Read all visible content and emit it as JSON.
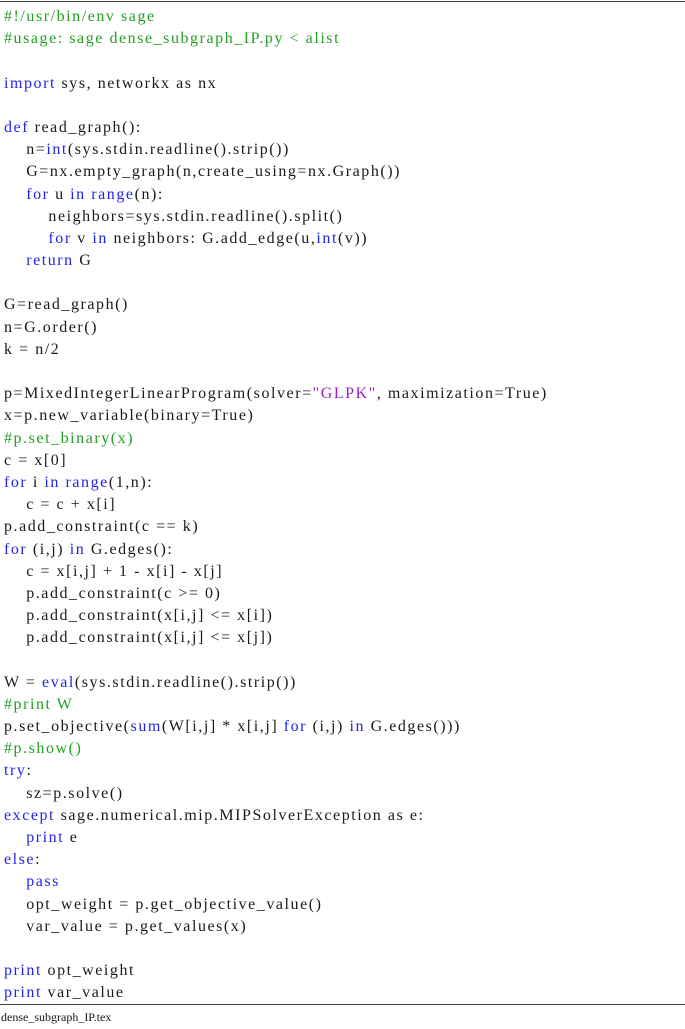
{
  "document": {
    "caption": "dense_subgraph_IP.tex",
    "colors": {
      "keyword": "#2424e8",
      "comment": "#22a022",
      "string": "#9a1fc0",
      "text": "#1a1a1a"
    },
    "indent_unit": "    ",
    "lines": [
      {
        "indent": 0,
        "tokens": [
          {
            "t": "comment",
            "v": "#!/usr/bin/env sage"
          }
        ]
      },
      {
        "indent": 0,
        "tokens": [
          {
            "t": "comment",
            "v": "#usage: sage dense_subgraph_IP.py < alist"
          }
        ]
      },
      {
        "indent": 0,
        "tokens": []
      },
      {
        "indent": 0,
        "tokens": [
          {
            "t": "kw",
            "v": "import"
          },
          {
            "t": "plain",
            "v": " sys, networkx as nx"
          }
        ]
      },
      {
        "indent": 0,
        "tokens": []
      },
      {
        "indent": 0,
        "tokens": [
          {
            "t": "kw",
            "v": "def"
          },
          {
            "t": "plain",
            "v": " read_graph():"
          }
        ]
      },
      {
        "indent": 1,
        "tokens": [
          {
            "t": "plain",
            "v": "n="
          },
          {
            "t": "kw",
            "v": "int"
          },
          {
            "t": "plain",
            "v": "(sys.stdin.readline().strip())"
          }
        ]
      },
      {
        "indent": 1,
        "tokens": [
          {
            "t": "plain",
            "v": "G=nx.empty_graph(n,create_using=nx.Graph())"
          }
        ]
      },
      {
        "indent": 1,
        "tokens": [
          {
            "t": "kw",
            "v": "for"
          },
          {
            "t": "plain",
            "v": " u "
          },
          {
            "t": "kw",
            "v": "in"
          },
          {
            "t": "plain",
            "v": " "
          },
          {
            "t": "kw",
            "v": "range"
          },
          {
            "t": "plain",
            "v": "(n):"
          }
        ]
      },
      {
        "indent": 2,
        "tokens": [
          {
            "t": "plain",
            "v": "neighbors=sys.stdin.readline().split()"
          }
        ]
      },
      {
        "indent": 2,
        "tokens": [
          {
            "t": "kw",
            "v": "for"
          },
          {
            "t": "plain",
            "v": " v "
          },
          {
            "t": "kw",
            "v": "in"
          },
          {
            "t": "plain",
            "v": " neighbors: G.add_edge(u,"
          },
          {
            "t": "kw",
            "v": "int"
          },
          {
            "t": "plain",
            "v": "(v))"
          }
        ]
      },
      {
        "indent": 1,
        "tokens": [
          {
            "t": "kw",
            "v": "return"
          },
          {
            "t": "plain",
            "v": " G"
          }
        ]
      },
      {
        "indent": 0,
        "tokens": []
      },
      {
        "indent": 0,
        "tokens": [
          {
            "t": "plain",
            "v": "G=read_graph()"
          }
        ]
      },
      {
        "indent": 0,
        "tokens": [
          {
            "t": "plain",
            "v": "n=G.order()"
          }
        ]
      },
      {
        "indent": 0,
        "tokens": [
          {
            "t": "plain",
            "v": "k = n/2"
          }
        ]
      },
      {
        "indent": 0,
        "tokens": []
      },
      {
        "indent": 0,
        "tokens": [
          {
            "t": "plain",
            "v": "p=MixedIntegerLinearProgram(solver="
          },
          {
            "t": "string",
            "v": "\"GLPK\""
          },
          {
            "t": "plain",
            "v": ", maximization=True)"
          }
        ]
      },
      {
        "indent": 0,
        "tokens": [
          {
            "t": "plain",
            "v": "x=p.new_variable(binary=True)"
          }
        ]
      },
      {
        "indent": 0,
        "tokens": [
          {
            "t": "comment",
            "v": "#p.set_binary(x)"
          }
        ]
      },
      {
        "indent": 0,
        "tokens": [
          {
            "t": "plain",
            "v": "c = x[0]"
          }
        ]
      },
      {
        "indent": 0,
        "tokens": [
          {
            "t": "kw",
            "v": "for"
          },
          {
            "t": "plain",
            "v": " i "
          },
          {
            "t": "kw",
            "v": "in"
          },
          {
            "t": "plain",
            "v": " "
          },
          {
            "t": "kw",
            "v": "range"
          },
          {
            "t": "plain",
            "v": "(1,n):"
          }
        ]
      },
      {
        "indent": 1,
        "tokens": [
          {
            "t": "plain",
            "v": "c = c + x[i]"
          }
        ]
      },
      {
        "indent": 0,
        "tokens": [
          {
            "t": "plain",
            "v": "p.add_constraint(c == k)"
          }
        ]
      },
      {
        "indent": 0,
        "tokens": [
          {
            "t": "kw",
            "v": "for"
          },
          {
            "t": "plain",
            "v": " (i,j) "
          },
          {
            "t": "kw",
            "v": "in"
          },
          {
            "t": "plain",
            "v": " G.edges():"
          }
        ]
      },
      {
        "indent": 1,
        "tokens": [
          {
            "t": "plain",
            "v": "c = x[i,j] + 1 - x[i] - x[j]"
          }
        ]
      },
      {
        "indent": 1,
        "tokens": [
          {
            "t": "plain",
            "v": "p.add_constraint(c >= 0)"
          }
        ]
      },
      {
        "indent": 1,
        "tokens": [
          {
            "t": "plain",
            "v": "p.add_constraint(x[i,j] <= x[i])"
          }
        ]
      },
      {
        "indent": 1,
        "tokens": [
          {
            "t": "plain",
            "v": "p.add_constraint(x[i,j] <= x[j])"
          }
        ]
      },
      {
        "indent": 0,
        "tokens": []
      },
      {
        "indent": 0,
        "tokens": [
          {
            "t": "plain",
            "v": "W = "
          },
          {
            "t": "kw",
            "v": "eval"
          },
          {
            "t": "plain",
            "v": "(sys.stdin.readline().strip())"
          }
        ]
      },
      {
        "indent": 0,
        "tokens": [
          {
            "t": "comment",
            "v": "#print W"
          }
        ]
      },
      {
        "indent": 0,
        "tokens": [
          {
            "t": "plain",
            "v": "p.set_objective("
          },
          {
            "t": "kw",
            "v": "sum"
          },
          {
            "t": "plain",
            "v": "(W[i,j] * x[i,j] "
          },
          {
            "t": "kw",
            "v": "for"
          },
          {
            "t": "plain",
            "v": " (i,j) "
          },
          {
            "t": "kw",
            "v": "in"
          },
          {
            "t": "plain",
            "v": " G.edges()))"
          }
        ]
      },
      {
        "indent": 0,
        "tokens": [
          {
            "t": "comment",
            "v": "#p.show()"
          }
        ]
      },
      {
        "indent": 0,
        "tokens": [
          {
            "t": "kw",
            "v": "try"
          },
          {
            "t": "plain",
            "v": ":"
          }
        ]
      },
      {
        "indent": 1,
        "tokens": [
          {
            "t": "plain",
            "v": "sz=p.solve()"
          }
        ]
      },
      {
        "indent": 0,
        "tokens": [
          {
            "t": "kw",
            "v": "except"
          },
          {
            "t": "plain",
            "v": " sage.numerical.mip.MIPSolverException as e:"
          }
        ]
      },
      {
        "indent": 1,
        "tokens": [
          {
            "t": "kw",
            "v": "print"
          },
          {
            "t": "plain",
            "v": " e"
          }
        ]
      },
      {
        "indent": 0,
        "tokens": [
          {
            "t": "kw",
            "v": "else"
          },
          {
            "t": "plain",
            "v": ":"
          }
        ]
      },
      {
        "indent": 1,
        "tokens": [
          {
            "t": "kw",
            "v": "pass"
          }
        ]
      },
      {
        "indent": 1,
        "tokens": [
          {
            "t": "plain",
            "v": "opt_weight = p.get_objective_value()"
          }
        ]
      },
      {
        "indent": 1,
        "tokens": [
          {
            "t": "plain",
            "v": "var_value = p.get_values(x)"
          }
        ]
      },
      {
        "indent": 0,
        "tokens": []
      },
      {
        "indent": 0,
        "tokens": [
          {
            "t": "kw",
            "v": "print"
          },
          {
            "t": "plain",
            "v": " opt_weight"
          }
        ]
      },
      {
        "indent": 0,
        "tokens": [
          {
            "t": "kw",
            "v": "print"
          },
          {
            "t": "plain",
            "v": " var_value"
          }
        ]
      }
    ]
  }
}
